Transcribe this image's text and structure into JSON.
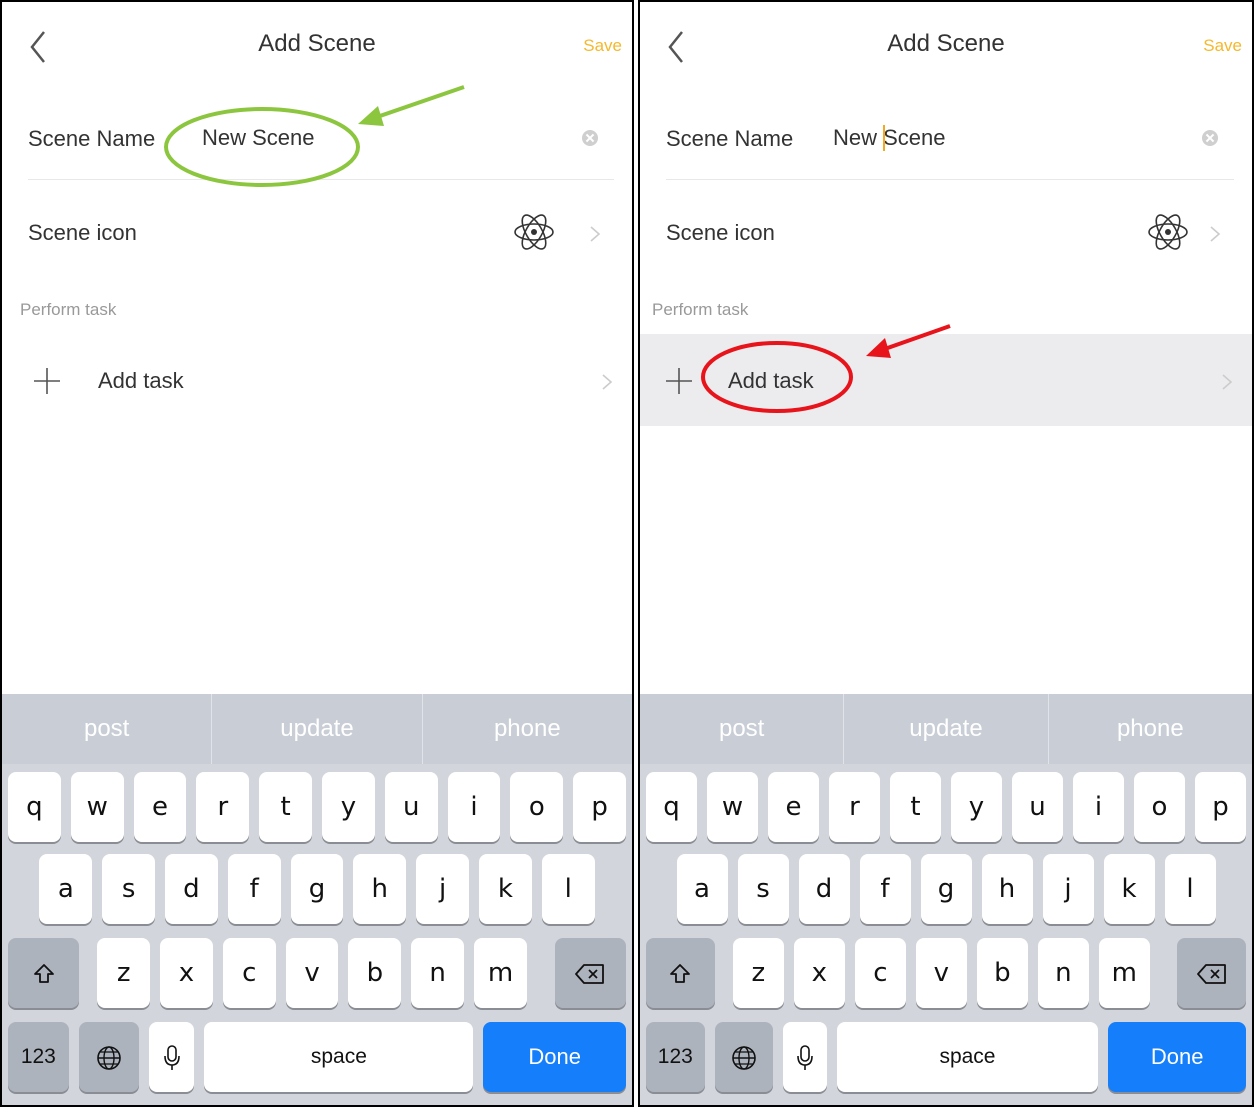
{
  "panels": [
    {
      "title": "Add Scene",
      "save_label": "Save",
      "scene_name_label": "Scene Name",
      "scene_name_value": "New Scene",
      "scene_icon_label": "Scene icon",
      "section_label": "Perform task",
      "add_task_label": "Add task",
      "annotation": "green-circle-around-name-field",
      "suggestions": [
        "post",
        "update",
        "phone"
      ],
      "keys": {
        "row1": [
          "q",
          "w",
          "e",
          "r",
          "t",
          "y",
          "u",
          "i",
          "o",
          "p"
        ],
        "row2": [
          "a",
          "s",
          "d",
          "f",
          "g",
          "h",
          "j",
          "k",
          "l"
        ],
        "row3": [
          "z",
          "x",
          "c",
          "v",
          "b",
          "n",
          "m"
        ],
        "numbers_label": "123",
        "space_label": "space",
        "done_label": "Done"
      }
    },
    {
      "title": "Add Scene",
      "save_label": "Save",
      "scene_name_label": "Scene Name",
      "scene_name_value": "New Scene",
      "scene_icon_label": "Scene icon",
      "section_label": "Perform task",
      "add_task_label": "Add task",
      "annotation": "red-circle-around-add-task",
      "suggestions": [
        "post",
        "update",
        "phone"
      ],
      "keys": {
        "row1": [
          "q",
          "w",
          "e",
          "r",
          "t",
          "y",
          "u",
          "i",
          "o",
          "p"
        ],
        "row2": [
          "a",
          "s",
          "d",
          "f",
          "g",
          "h",
          "j",
          "k",
          "l"
        ],
        "row3": [
          "z",
          "x",
          "c",
          "v",
          "b",
          "n",
          "m"
        ],
        "numbers_label": "123",
        "space_label": "space",
        "done_label": "Done"
      }
    }
  ],
  "colors": {
    "save": "#f5b82e",
    "done_key": "#147efb",
    "annotation_green": "#8cc63f",
    "annotation_red": "#e8141b",
    "cursor": "#f5a623"
  },
  "icons": [
    "back-chevron-icon",
    "clear-icon",
    "atom-icon",
    "chevron-right-icon",
    "plus-icon",
    "shift-icon",
    "delete-icon",
    "globe-icon",
    "microphone-icon"
  ]
}
